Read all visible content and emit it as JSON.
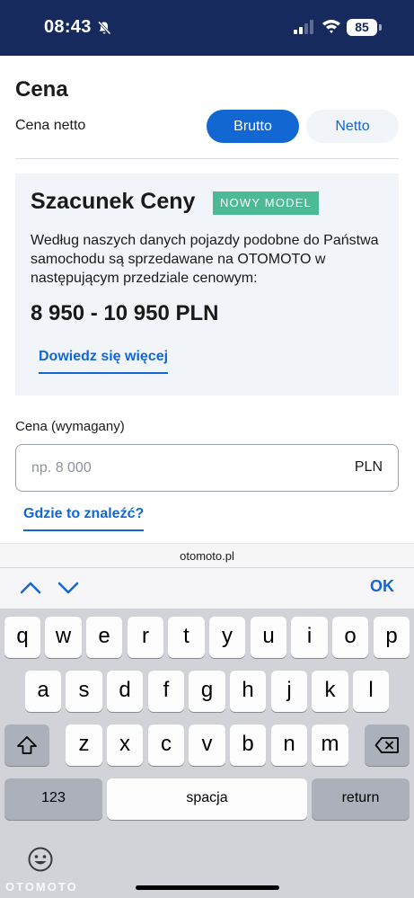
{
  "status_bar": {
    "time": "08:43",
    "battery": "85"
  },
  "form": {
    "section_title": "Cena",
    "price_type_label": "Cena netto",
    "toggle_gross": "Brutto",
    "toggle_net": "Netto",
    "selected_toggle": "Brutto"
  },
  "estimate": {
    "title": "Szacunek Ceny",
    "badge": "NOWY MODEL",
    "description": "Według naszych danych pojazdy podobne do Państwa samochodu są sprzedawane na OTOMOTO w następującym przedziale cenowym:",
    "range": "8 950 - 10 950 PLN",
    "link": "Dowiedz się więcej"
  },
  "price_field": {
    "label": "Cena (wymagany)",
    "placeholder": "np. 8 000",
    "value": "",
    "currency": "PLN",
    "help_link": "Gdzie to znaleźć?"
  },
  "browser": {
    "url": "otomoto.pl"
  },
  "accessory": {
    "done": "OK"
  },
  "keyboard": {
    "row1": [
      "q",
      "w",
      "e",
      "r",
      "t",
      "y",
      "u",
      "i",
      "o",
      "p"
    ],
    "row2": [
      "a",
      "s",
      "d",
      "f",
      "g",
      "h",
      "j",
      "k",
      "l"
    ],
    "row3": [
      "z",
      "x",
      "c",
      "v",
      "b",
      "n",
      "m"
    ],
    "numbers_key": "123",
    "space_key": "spacja",
    "return_key": "return"
  },
  "watermark": "OTOMOTO",
  "colors": {
    "brand_navy": "#172a5e",
    "accent_blue": "#1267d3",
    "badge_green": "#4cbb95",
    "card_background": "#f1f4f8"
  }
}
